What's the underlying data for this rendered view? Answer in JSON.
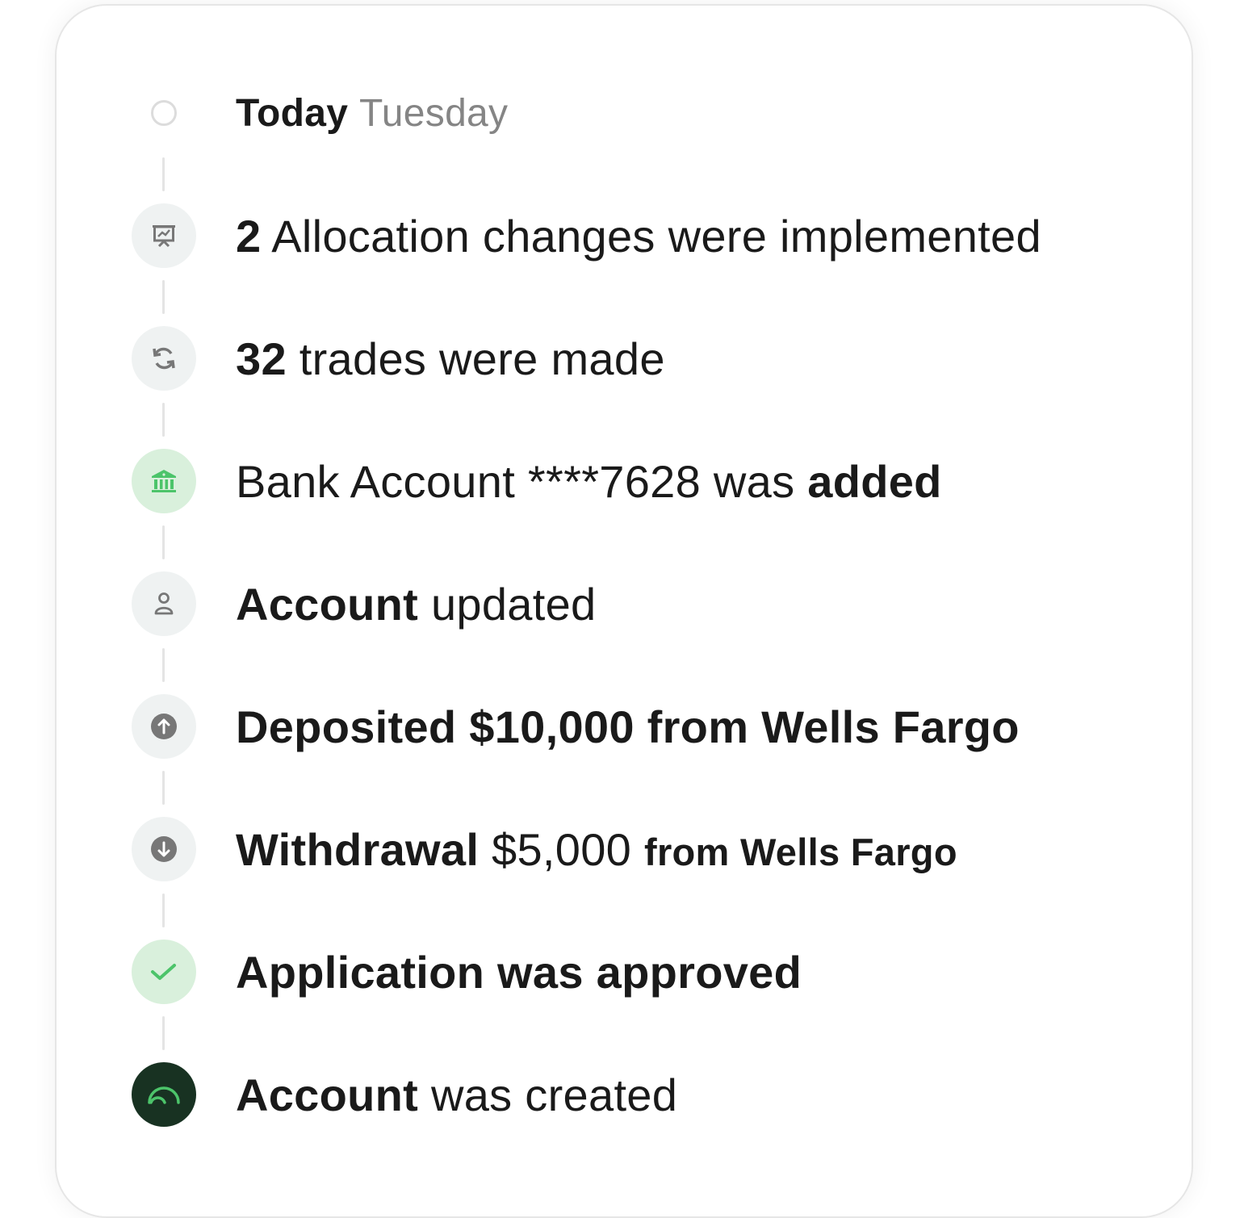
{
  "header": {
    "today": "Today",
    "day": "Tuesday"
  },
  "items": [
    {
      "icon": "presentation-chart-icon",
      "parts": [
        "2",
        " Allocation changes were implemented"
      ]
    },
    {
      "icon": "refresh-icon",
      "parts": [
        "32",
        " trades were made"
      ]
    },
    {
      "icon": "bank-icon",
      "parts": [
        "Bank Account ****7628 was ",
        "added"
      ]
    },
    {
      "icon": "user-icon",
      "parts": [
        "Account",
        " updated"
      ]
    },
    {
      "icon": "arrow-up-circle-icon",
      "parts": [
        "Deposited $10,000 from Wells Fargo"
      ]
    },
    {
      "icon": "arrow-down-circle-icon",
      "parts": [
        "Withdrawal",
        " $5,000 ",
        "from Wells Fargo"
      ]
    },
    {
      "icon": "check-icon",
      "parts": [
        "Application was approved"
      ]
    },
    {
      "icon": "logo-arc-icon",
      "parts": [
        "Account",
        " was created"
      ]
    }
  ],
  "colors": {
    "green": "#4cc46a",
    "greenBg": "#d9f0dc",
    "dark": "#183222",
    "grey": "#767676"
  }
}
